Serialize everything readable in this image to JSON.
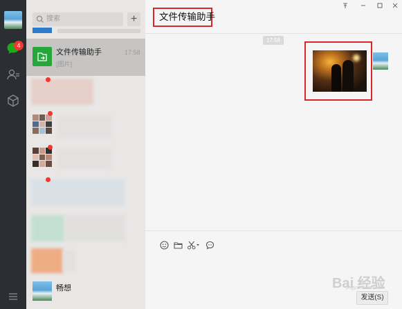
{
  "sidebar": {
    "chat_badge": "4",
    "icons": [
      "chat-icon",
      "contacts-icon",
      "favorites-icon",
      "menu-icon"
    ]
  },
  "conversation_list": {
    "search_placeholder": "搜索",
    "add_label": "+",
    "items": [
      {
        "name": "文件传输助手",
        "time": "17:58",
        "preview": "[图片]"
      },
      {
        "name": "畅想"
      }
    ]
  },
  "chat": {
    "title": "文件传输助手",
    "message_time": "17:58",
    "send_label": "发送(S)"
  },
  "window_controls": [
    "pin-icon",
    "minimize-icon",
    "maximize-icon",
    "close-icon"
  ],
  "watermark": {
    "main": "Bai 经验",
    "sub": "jingyan.baidu.com"
  },
  "colors": {
    "accent_green": "#25a73b",
    "highlight_red": "#d9262b",
    "sidebar_dark": "#2b2e32",
    "badge_red": "#f43530"
  }
}
